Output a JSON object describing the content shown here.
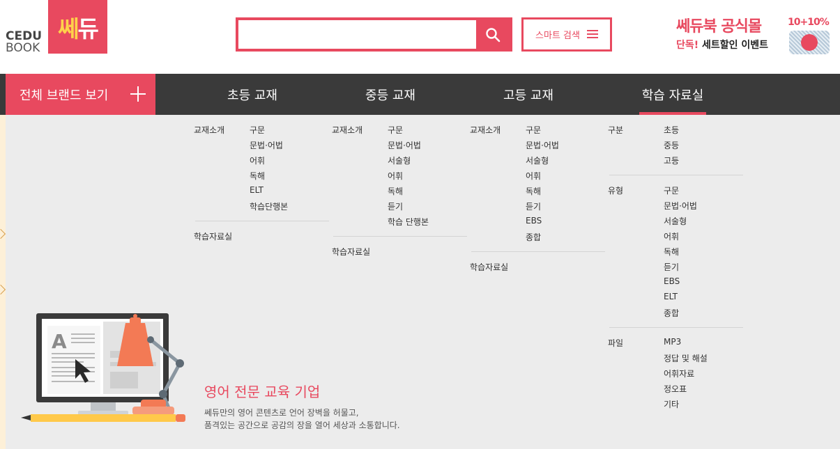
{
  "header": {
    "logo_cedu_line1": "CEDU",
    "logo_cedu_line2": "BOOK",
    "logo_ssedu_prefix": "쎄",
    "logo_ssedu_suffix": "듀",
    "search": {
      "placeholder": "",
      "value": ""
    },
    "smart_search_label": "스마트 검색",
    "banner": {
      "title": "쎄듀북 공식몰",
      "sub_red": "단독!",
      "sub_dark": "세트할인 이벤트",
      "badge": "10+10%"
    }
  },
  "nav": {
    "all_brands": "전체 브랜드 보기",
    "items": [
      {
        "label": "초등 교재"
      },
      {
        "label": "중등 교재"
      },
      {
        "label": "고등 교재"
      },
      {
        "label": "학습 자료실"
      }
    ]
  },
  "menu": {
    "elementary": {
      "intro_label": "교재소개",
      "links": [
        "구문",
        "문법·어법",
        "어휘",
        "독해",
        "ELT",
        "학습단행본"
      ],
      "resources": "학습자료실"
    },
    "middle": {
      "intro_label": "교재소개",
      "links": [
        "구문",
        "문법·어법",
        "서술형",
        "어휘",
        "독해",
        "듣기",
        "학습 단행본"
      ],
      "resources": "학습자료실"
    },
    "high": {
      "intro_label": "교재소개",
      "links": [
        "구문",
        "문법·어법",
        "서술형",
        "어휘",
        "독해",
        "듣기",
        "EBS",
        "종합"
      ],
      "resources": "학습자료실"
    },
    "library": {
      "level_label": "구분",
      "levels": [
        "초등",
        "중등",
        "고등"
      ],
      "type_label": "유형",
      "types": [
        "구문",
        "문법·어법",
        "서술형",
        "어휘",
        "독해",
        "듣기",
        "EBS",
        "ELT",
        "종합"
      ],
      "file_label": "파일",
      "files": [
        "MP3",
        "정답 및 해설",
        "어휘자료",
        "정오표",
        "기타"
      ]
    }
  },
  "promo": {
    "title": "영어 전문 교육 기업",
    "line1": "쎄듀만의 영어 콘텐츠로 언어 장벽을 허물고,",
    "line2": "품격있는 공간으로 공감의 장을 열어 세상과 소통합니다.",
    "illustration_letter": "A"
  },
  "colors": {
    "accent": "#e8495f",
    "nav_bg": "#3a3a3a",
    "panel_bg": "#ececec"
  }
}
